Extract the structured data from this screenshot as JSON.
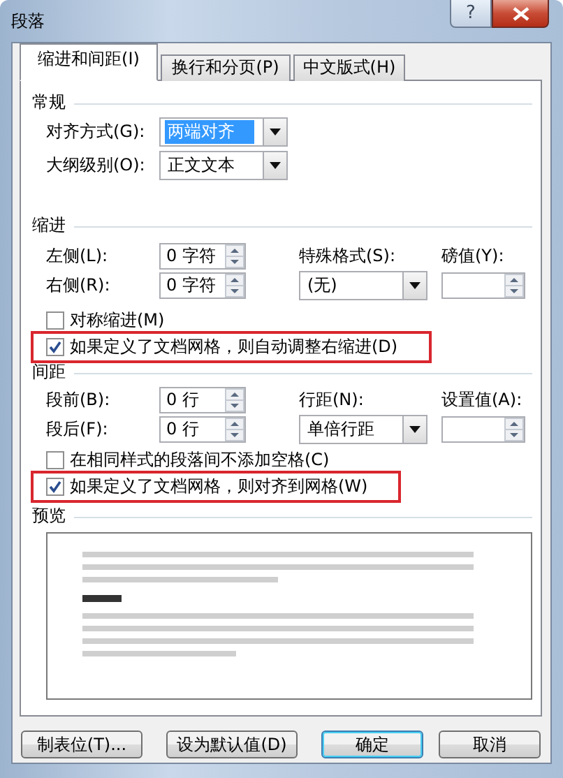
{
  "window": {
    "title": "段落",
    "help": "?"
  },
  "tabs": [
    {
      "label": "缩进和间距(I)",
      "selected": true
    },
    {
      "label": "换行和分页(P)",
      "selected": false
    },
    {
      "label": "中文版式(H)",
      "selected": false
    }
  ],
  "general": {
    "heading": "常规",
    "fields": [
      {
        "label": "对齐方式(G):",
        "value": "两端对齐",
        "selected": true
      },
      {
        "label": "大纲级别(O):",
        "value": "正文文本",
        "selected": false
      }
    ]
  },
  "indentation": {
    "heading": "缩进",
    "left": {
      "label": "左侧(L):",
      "value": "0 字符"
    },
    "right": {
      "label": "右侧(R):",
      "value": "0 字符"
    },
    "special": {
      "label": "特殊格式(S):",
      "value": "(无)"
    },
    "by": {
      "label": "磅值(Y):"
    },
    "checkboxes": [
      {
        "label": "对称缩进(M)",
        "checked": false,
        "highlighted": false
      },
      {
        "label": "如果定义了文档网格，则自动调整右缩进(D)",
        "checked": true,
        "highlighted": true
      }
    ]
  },
  "spacing": {
    "heading": "间距",
    "left": {
      "label": "段前(B):",
      "value": "0 行"
    },
    "right": {
      "label": "段后(F):",
      "value": "0 行"
    },
    "special": {
      "label": "行距(N):",
      "value": "单倍行距"
    },
    "by": {
      "label": "设置值(A):"
    },
    "checkboxes": [
      {
        "label": "在相同样式的段落间不添加空格(C)",
        "checked": false,
        "highlighted": false
      },
      {
        "label": "如果定义了文档网格，则对齐到网格(W)",
        "checked": true,
        "highlighted": true
      }
    ]
  },
  "preview": {
    "heading": "预览"
  },
  "buttons": [
    {
      "label": "制表位(T)...",
      "default": false
    },
    {
      "label": "设为默认值(D)",
      "default": false
    },
    {
      "label": "确定",
      "default": true
    },
    {
      "label": "取消",
      "default": false
    }
  ]
}
